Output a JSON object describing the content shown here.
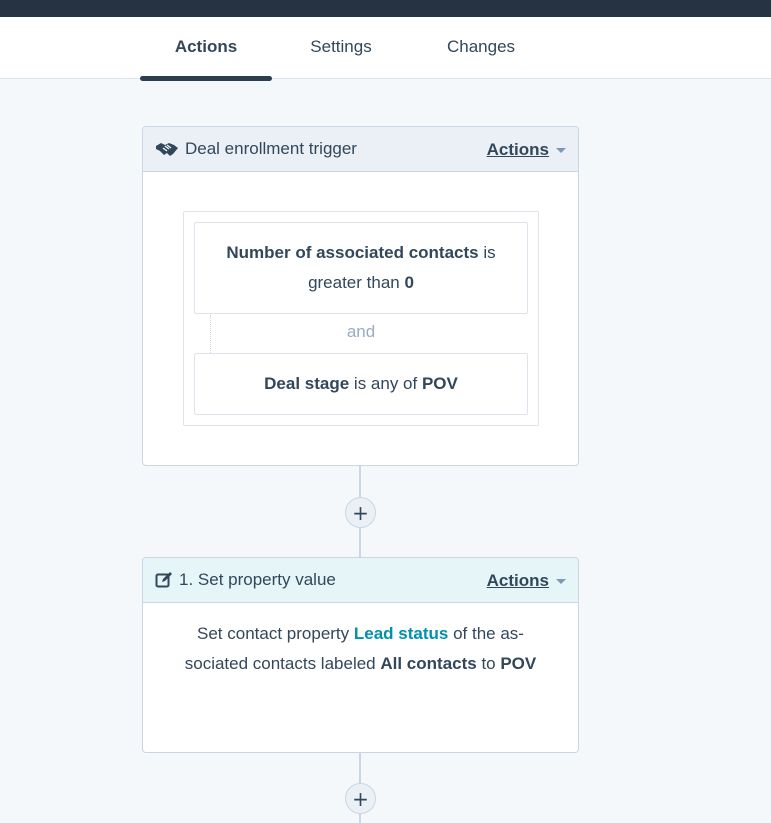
{
  "tabs": [
    {
      "label": "Actions",
      "active": true
    },
    {
      "label": "Settings",
      "active": false
    },
    {
      "label": "Changes",
      "active": false
    }
  ],
  "trigger": {
    "title": "Deal enrollment trigger",
    "actions_label": "Actions",
    "icon": "handshake-icon",
    "filters": [
      {
        "prop": "Number of associated contacts",
        "op": " is greater than ",
        "value": "0"
      },
      {
        "prop": "Deal stage",
        "op": " is any of ",
        "value": "POV"
      }
    ],
    "joiner": "and"
  },
  "action": {
    "title": "1. Set property value",
    "actions_label": "Actions",
    "icon": "edit-icon",
    "body": {
      "prefix": "Set contact property ",
      "property": "Lead status",
      "middle": " of the as-sociated contacts labeled ",
      "label": "All contacts",
      "to": " to ",
      "value": "POV"
    }
  },
  "add_button": "+",
  "colors": {
    "topbar": "#253342",
    "background": "#f5f8fa",
    "text": "#33475b",
    "link": "#0091ae",
    "trigger_header": "#eaf0f6",
    "action_header": "#e5f5f8",
    "border": "#cbd6e2"
  }
}
